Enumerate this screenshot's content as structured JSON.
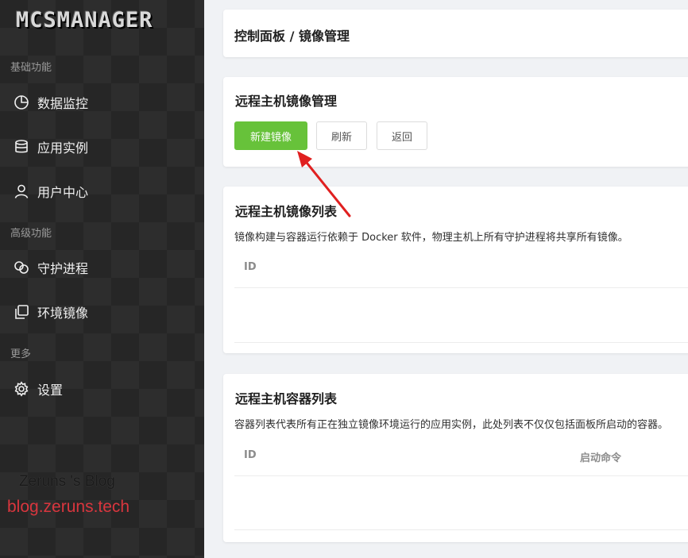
{
  "sidebar": {
    "logo": "MCSMANAGER",
    "groups": [
      {
        "title": "基础功能",
        "items": [
          {
            "label": "数据监控",
            "icon": "pie-chart-icon"
          },
          {
            "label": "应用实例",
            "icon": "database-icon"
          },
          {
            "label": "用户中心",
            "icon": "user-icon"
          }
        ]
      },
      {
        "title": "高级功能",
        "items": [
          {
            "label": "守护进程",
            "icon": "link-icon"
          },
          {
            "label": "环境镜像",
            "icon": "copy-icon"
          }
        ]
      },
      {
        "title": "更多",
        "items": [
          {
            "label": "设置",
            "icon": "gear-icon"
          }
        ]
      }
    ]
  },
  "breadcrumb": {
    "text": "控制面板 / 镜像管理"
  },
  "image_manage": {
    "title": "远程主机镜像管理",
    "buttons": {
      "new": "新建镜像",
      "refresh": "刷新",
      "back": "返回"
    }
  },
  "image_list": {
    "title": "远程主机镜像列表",
    "description": "镜像构建与容器运行依赖于 Docker 软件，物理主机上所有守护进程将共享所有镜像。",
    "columns": [
      "ID"
    ]
  },
  "container_list": {
    "title": "远程主机容器列表",
    "description": "容器列表代表所有正在独立镜像环境运行的应用实例，此处列表不仅仅包括面板所启动的容器。",
    "columns": [
      "ID",
      "启动命令"
    ]
  },
  "watermark": {
    "line1": "Zeruns 's Blog",
    "line2": "blog.zeruns.tech"
  },
  "colors": {
    "primary": "#67c23a",
    "annotation_arrow": "#e02020",
    "watermark_red": "#d9363e"
  }
}
